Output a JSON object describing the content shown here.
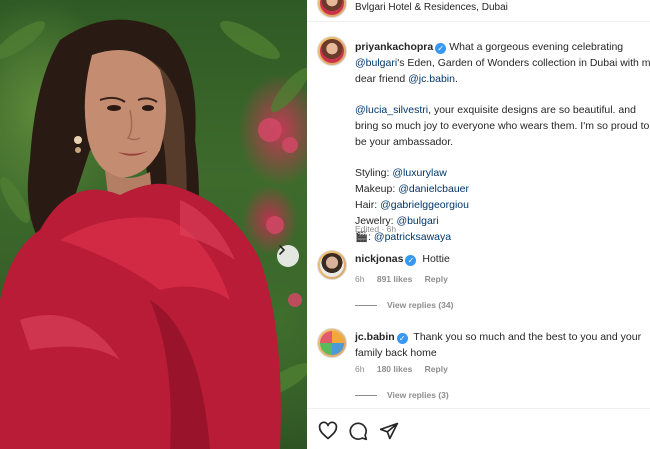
{
  "location": {
    "text": "Bvlgari Hotel & Residences, Dubai"
  },
  "caption": {
    "username": "priyankachopra",
    "line1": "What a gorgeous evening celebrating",
    "line2_mention": "@bulgari",
    "line2_rest": "'s Eden, Garden of Wonders collection in Dubai with my",
    "line3_pre": "dear friend ",
    "line3_mention": "@jc.babin",
    "line3_post": ".",
    "line4_mention": "@lucia_silvestri",
    "line4_rest": ", your exquisite designs are so beautiful. and",
    "line5": "bring so much joy to everyone who wears them. I'm so proud to",
    "line6": "be your ambassador.",
    "credits": [
      {
        "label": "Styling: ",
        "mention": "@luxurylaw"
      },
      {
        "label": "Makeup: ",
        "mention": "@danielcbauer"
      },
      {
        "label": "Hair: ",
        "mention": "@gabrielggeorgiou"
      },
      {
        "label": "Jewelry: ",
        "mention": "@bulgari"
      },
      {
        "label": "🎬: ",
        "mention": "@patricksawaya"
      }
    ],
    "edited": "Edited · 6h"
  },
  "comments": [
    {
      "username": "nickjonas",
      "text": "Hottie",
      "text_line2": "",
      "time": "6h",
      "likes": "891 likes",
      "reply": "Reply",
      "view_replies": "View replies (34)"
    },
    {
      "username": "jc.babin",
      "text": "Thank you so much and the best to you and your",
      "text_line2": "family back home",
      "time": "6h",
      "likes": "180 likes",
      "reply": "Reply",
      "view_replies": "View replies (3)"
    }
  ],
  "icons": {
    "like": "heart-icon",
    "comment": "comment-icon",
    "share": "share-icon",
    "carousel_next": "chevron-right-icon",
    "verified": "verified-badge-icon"
  },
  "colors": {
    "mention": "#00376b",
    "verified": "#3897f0",
    "muted": "#8e8e8e",
    "dress": "#c01f3a"
  }
}
